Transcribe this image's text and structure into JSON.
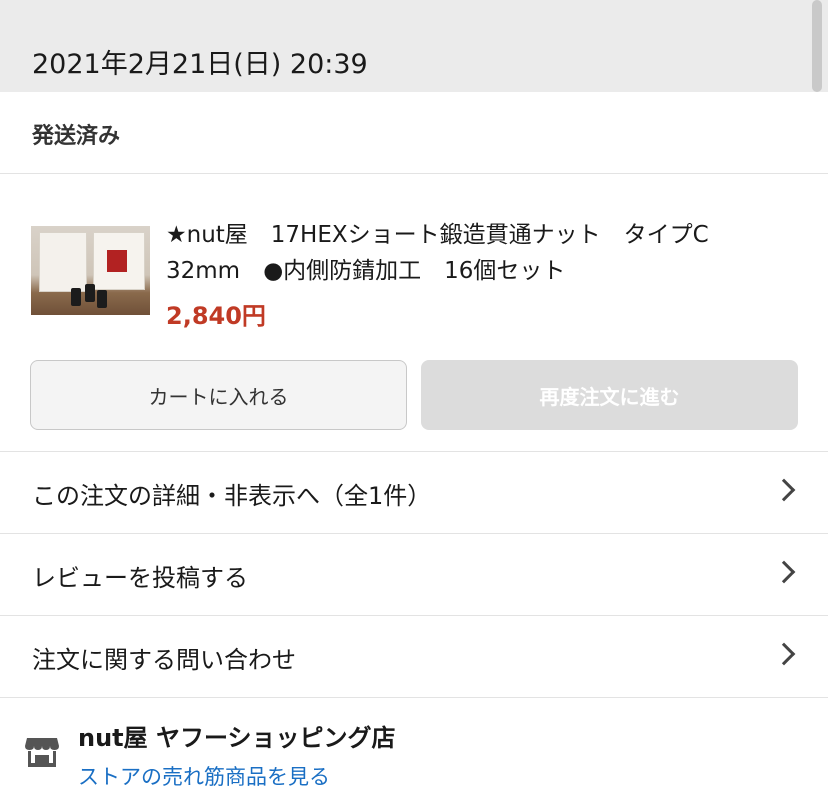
{
  "order": {
    "date": "2021年2月21日(日) 20:39",
    "status": "発送済み"
  },
  "product": {
    "title": "★nut屋　17HEXショート鍛造貫通ナット　タイプC　32mm　●内側防錆加工　16個セット",
    "price": "2,840円",
    "thumbnail_icon": "product-photo"
  },
  "buttons": {
    "cart": "カートに入れる",
    "reorder": "再度注文に進む"
  },
  "links": [
    {
      "label": "この注文の詳細・非表示へ（全1件）"
    },
    {
      "label": "レビューを投稿する"
    },
    {
      "label": "注文に関する問い合わせ"
    }
  ],
  "store": {
    "name": "nut屋 ヤフーショッピング店",
    "link": "ストアの売れ筋商品を見る",
    "icon": "store-icon"
  },
  "colors": {
    "price": "#c03a25",
    "link": "#1a6fc4",
    "disabled_button": "#dcdcdc"
  }
}
